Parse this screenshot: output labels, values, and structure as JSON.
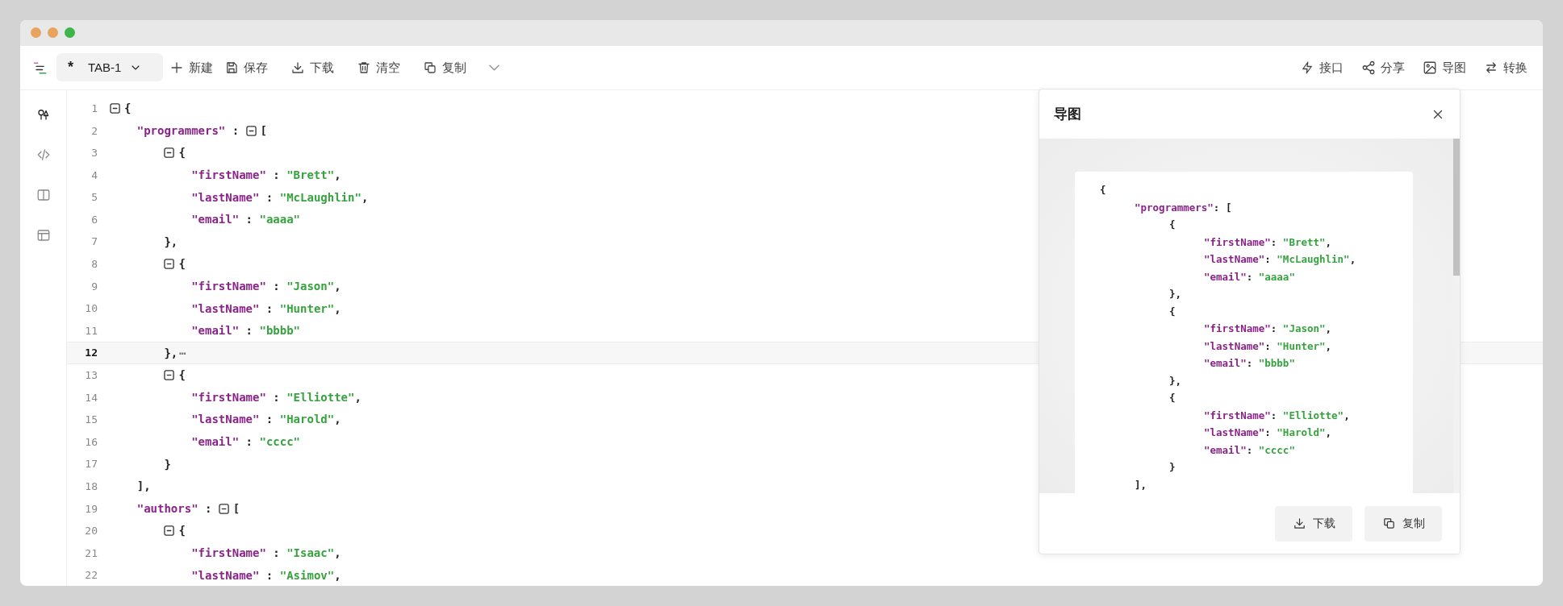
{
  "window": {
    "traffic_lights": [
      {
        "color": "#e8a35f"
      },
      {
        "color": "#e8a35f"
      },
      {
        "color": "#3cb54a"
      }
    ]
  },
  "toolbar": {
    "tab": {
      "mark": "*",
      "label": "TAB-1",
      "selected": true
    },
    "left_buttons": [
      {
        "label": "新建",
        "has_menu": false
      },
      {
        "label": "保存",
        "has_menu": false
      },
      {
        "label": "下载",
        "has_menu": false
      },
      {
        "label": "清空",
        "has_menu": false
      },
      {
        "label": "复制",
        "has_menu": true
      }
    ],
    "right_buttons": [
      {
        "label": "接口"
      },
      {
        "label": "分享"
      },
      {
        "label": "导图"
      },
      {
        "label": "转换"
      }
    ]
  },
  "sidebar": {
    "items": [
      {
        "selected": true
      },
      {
        "selected": false
      },
      {
        "selected": false
      },
      {
        "selected": false
      }
    ]
  },
  "editor": {
    "lines": [
      {
        "number": "1",
        "current": false,
        "tokens": [
          {
            "kind": "fold",
            "expanded": true
          },
          {
            "kind": "punct",
            "text": "{"
          }
        ],
        "children": [
          {
            "number": "2",
            "current": false,
            "tokens": [
              {
                "kind": "key",
                "text": "\"programmers\""
              },
              {
                "kind": "punct",
                "text": " : "
              },
              {
                "kind": "fold",
                "expanded": true
              },
              {
                "kind": "punct",
                "text": "["
              }
            ],
            "children": [
              {
                "number": "3",
                "current": false,
                "tokens": [
                  {
                    "kind": "fold",
                    "expanded": true
                  },
                  {
                    "kind": "punct",
                    "text": "{"
                  }
                ],
                "children": [
                  {
                    "number": "4",
                    "current": false,
                    "tokens": [
                      {
                        "kind": "key",
                        "text": "\"firstName\""
                      },
                      {
                        "kind": "punct",
                        "text": " : "
                      },
                      {
                        "kind": "string",
                        "text": "\"Brett\""
                      },
                      {
                        "kind": "punct",
                        "text": ","
                      }
                    ]
                  },
                  {
                    "number": "5",
                    "current": false,
                    "tokens": [
                      {
                        "kind": "key",
                        "text": "\"lastName\""
                      },
                      {
                        "kind": "punct",
                        "text": " : "
                      },
                      {
                        "kind": "string",
                        "text": "\"McLaughlin\""
                      },
                      {
                        "kind": "punct",
                        "text": ","
                      }
                    ]
                  },
                  {
                    "number": "6",
                    "current": false,
                    "tokens": [
                      {
                        "kind": "key",
                        "text": "\"email\""
                      },
                      {
                        "kind": "punct",
                        "text": " : "
                      },
                      {
                        "kind": "string",
                        "text": "\"aaaa\""
                      }
                    ]
                  }
                ]
              },
              {
                "number": "7",
                "current": false,
                "tokens": [
                  {
                    "kind": "punct",
                    "text": "},"
                  }
                ]
              },
              {
                "number": "8",
                "current": false,
                "tokens": [
                  {
                    "kind": "fold",
                    "expanded": true
                  },
                  {
                    "kind": "punct",
                    "text": "{"
                  }
                ],
                "children": [
                  {
                    "number": "9",
                    "current": false,
                    "tokens": [
                      {
                        "kind": "key",
                        "text": "\"firstName\""
                      },
                      {
                        "kind": "punct",
                        "text": " : "
                      },
                      {
                        "kind": "string",
                        "text": "\"Jason\""
                      },
                      {
                        "kind": "punct",
                        "text": ","
                      }
                    ]
                  },
                  {
                    "number": "10",
                    "current": false,
                    "tokens": [
                      {
                        "kind": "key",
                        "text": "\"lastName\""
                      },
                      {
                        "kind": "punct",
                        "text": " : "
                      },
                      {
                        "kind": "string",
                        "text": "\"Hunter\""
                      },
                      {
                        "kind": "punct",
                        "text": ","
                      }
                    ]
                  },
                  {
                    "number": "11",
                    "current": false,
                    "tokens": [
                      {
                        "kind": "key",
                        "text": "\"email\""
                      },
                      {
                        "kind": "punct",
                        "text": " : "
                      },
                      {
                        "kind": "string",
                        "text": "\"bbbb\""
                      }
                    ]
                  }
                ]
              },
              {
                "number": "12",
                "current": true,
                "tokens": [
                  {
                    "kind": "punct",
                    "text": "},"
                  },
                  {
                    "kind": "ellipsis",
                    "text": "⋯"
                  }
                ]
              },
              {
                "number": "13",
                "current": false,
                "tokens": [
                  {
                    "kind": "fold",
                    "expanded": true
                  },
                  {
                    "kind": "punct",
                    "text": "{"
                  }
                ],
                "children": [
                  {
                    "number": "14",
                    "current": false,
                    "tokens": [
                      {
                        "kind": "key",
                        "text": "\"firstName\""
                      },
                      {
                        "kind": "punct",
                        "text": " : "
                      },
                      {
                        "kind": "string",
                        "text": "\"Elliotte\""
                      },
                      {
                        "kind": "punct",
                        "text": ","
                      }
                    ]
                  },
                  {
                    "number": "15",
                    "current": false,
                    "tokens": [
                      {
                        "kind": "key",
                        "text": "\"lastName\""
                      },
                      {
                        "kind": "punct",
                        "text": " : "
                      },
                      {
                        "kind": "string",
                        "text": "\"Harold\""
                      },
                      {
                        "kind": "punct",
                        "text": ","
                      }
                    ]
                  },
                  {
                    "number": "16",
                    "current": false,
                    "tokens": [
                      {
                        "kind": "key",
                        "text": "\"email\""
                      },
                      {
                        "kind": "punct",
                        "text": " : "
                      },
                      {
                        "kind": "string",
                        "text": "\"cccc\""
                      }
                    ]
                  }
                ]
              },
              {
                "number": "17",
                "current": false,
                "tokens": [
                  {
                    "kind": "punct",
                    "text": "}"
                  }
                ]
              }
            ]
          },
          {
            "number": "18",
            "current": false,
            "tokens": [
              {
                "kind": "punct",
                "text": "],"
              }
            ]
          },
          {
            "number": "19",
            "current": false,
            "tokens": [
              {
                "kind": "key",
                "text": "\"authors\""
              },
              {
                "kind": "punct",
                "text": " : "
              },
              {
                "kind": "fold",
                "expanded": true
              },
              {
                "kind": "punct",
                "text": "["
              }
            ],
            "children": [
              {
                "number": "20",
                "current": false,
                "tokens": [
                  {
                    "kind": "fold",
                    "expanded": true
                  },
                  {
                    "kind": "punct",
                    "text": "{"
                  }
                ],
                "children": [
                  {
                    "number": "21",
                    "current": false,
                    "tokens": [
                      {
                        "kind": "key",
                        "text": "\"firstName\""
                      },
                      {
                        "kind": "punct",
                        "text": " : "
                      },
                      {
                        "kind": "string",
                        "text": "\"Isaac\""
                      },
                      {
                        "kind": "punct",
                        "text": ","
                      }
                    ]
                  },
                  {
                    "number": "22",
                    "current": false,
                    "tokens": [
                      {
                        "kind": "key",
                        "text": "\"lastName\""
                      },
                      {
                        "kind": "punct",
                        "text": " : "
                      },
                      {
                        "kind": "string",
                        "text": "\"Asimov\""
                      },
                      {
                        "kind": "punct",
                        "text": ","
                      }
                    ]
                  }
                ]
              }
            ]
          }
        ]
      }
    ]
  },
  "dialog": {
    "title": "导图",
    "preview_lines": [
      {
        "tokens": [
          {
            "kind": "punct",
            "text": "{"
          }
        ],
        "children": [
          {
            "tokens": [
              {
                "kind": "key",
                "text": "\"programmers\""
              },
              {
                "kind": "punct",
                "text": ": ["
              }
            ],
            "children": [
              {
                "tokens": [
                  {
                    "kind": "punct",
                    "text": "{"
                  }
                ],
                "children": [
                  {
                    "tokens": [
                      {
                        "kind": "key",
                        "text": "\"firstName\""
                      },
                      {
                        "kind": "punct",
                        "text": ": "
                      },
                      {
                        "kind": "string",
                        "text": "\"Brett\""
                      },
                      {
                        "kind": "punct",
                        "text": ","
                      }
                    ]
                  },
                  {
                    "tokens": [
                      {
                        "kind": "key",
                        "text": "\"lastName\""
                      },
                      {
                        "kind": "punct",
                        "text": ": "
                      },
                      {
                        "kind": "string",
                        "text": "\"McLaughlin\""
                      },
                      {
                        "kind": "punct",
                        "text": ","
                      }
                    ]
                  },
                  {
                    "tokens": [
                      {
                        "kind": "key",
                        "text": "\"email\""
                      },
                      {
                        "kind": "punct",
                        "text": ": "
                      },
                      {
                        "kind": "string",
                        "text": "\"aaaa\""
                      }
                    ]
                  }
                ]
              },
              {
                "tokens": [
                  {
                    "kind": "punct",
                    "text": "},"
                  }
                ]
              },
              {
                "tokens": [
                  {
                    "kind": "punct",
                    "text": "{"
                  }
                ],
                "children": [
                  {
                    "tokens": [
                      {
                        "kind": "key",
                        "text": "\"firstName\""
                      },
                      {
                        "kind": "punct",
                        "text": ": "
                      },
                      {
                        "kind": "string",
                        "text": "\"Jason\""
                      },
                      {
                        "kind": "punct",
                        "text": ","
                      }
                    ]
                  },
                  {
                    "tokens": [
                      {
                        "kind": "key",
                        "text": "\"lastName\""
                      },
                      {
                        "kind": "punct",
                        "text": ": "
                      },
                      {
                        "kind": "string",
                        "text": "\"Hunter\""
                      },
                      {
                        "kind": "punct",
                        "text": ","
                      }
                    ]
                  },
                  {
                    "tokens": [
                      {
                        "kind": "key",
                        "text": "\"email\""
                      },
                      {
                        "kind": "punct",
                        "text": ": "
                      },
                      {
                        "kind": "string",
                        "text": "\"bbbb\""
                      }
                    ]
                  }
                ]
              },
              {
                "tokens": [
                  {
                    "kind": "punct",
                    "text": "},"
                  }
                ]
              },
              {
                "tokens": [
                  {
                    "kind": "punct",
                    "text": "{"
                  }
                ],
                "children": [
                  {
                    "tokens": [
                      {
                        "kind": "key",
                        "text": "\"firstName\""
                      },
                      {
                        "kind": "punct",
                        "text": ": "
                      },
                      {
                        "kind": "string",
                        "text": "\"Elliotte\""
                      },
                      {
                        "kind": "punct",
                        "text": ","
                      }
                    ]
                  },
                  {
                    "tokens": [
                      {
                        "kind": "key",
                        "text": "\"lastName\""
                      },
                      {
                        "kind": "punct",
                        "text": ": "
                      },
                      {
                        "kind": "string",
                        "text": "\"Harold\""
                      },
                      {
                        "kind": "punct",
                        "text": ","
                      }
                    ]
                  },
                  {
                    "tokens": [
                      {
                        "kind": "key",
                        "text": "\"email\""
                      },
                      {
                        "kind": "punct",
                        "text": ": "
                      },
                      {
                        "kind": "string",
                        "text": "\"cccc\""
                      }
                    ]
                  }
                ]
              },
              {
                "tokens": [
                  {
                    "kind": "punct",
                    "text": "}"
                  }
                ]
              }
            ]
          },
          {
            "tokens": [
              {
                "kind": "punct",
                "text": "],"
              }
            ]
          }
        ]
      }
    ],
    "buttons": [
      {
        "label": "下载"
      },
      {
        "label": "复制"
      }
    ]
  }
}
